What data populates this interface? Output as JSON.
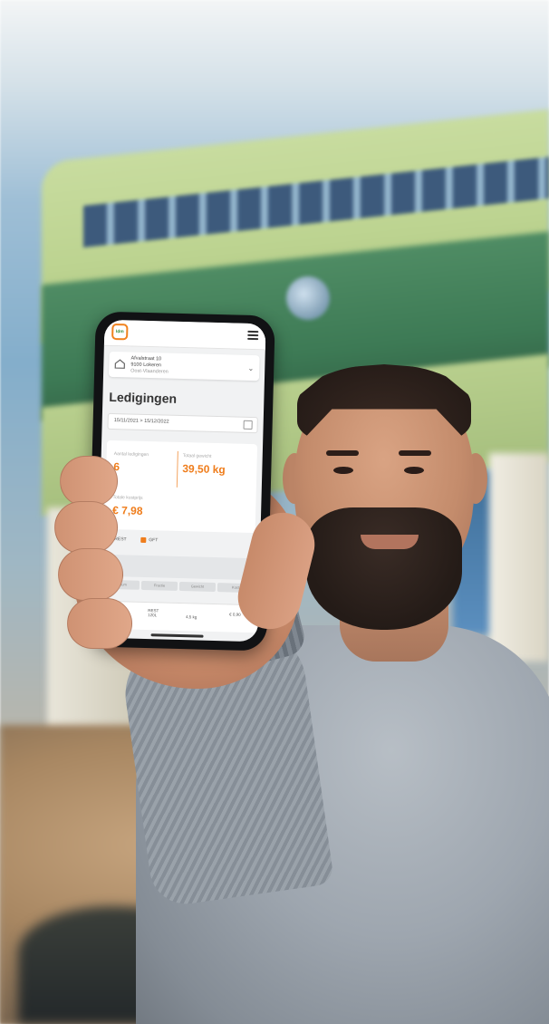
{
  "app": {
    "title": "Ledigingen",
    "logo_text": "Idm",
    "accent_color": "#ef7d1c",
    "icons": [
      "home-icon",
      "menu-icon",
      "chevron-down-icon",
      "calendar-icon"
    ]
  },
  "address": {
    "line1": "Afvalstraat 10",
    "line2": "9100 Lokeren",
    "line3": "Oost-Vlaanderen"
  },
  "filter": {
    "date_range": "15/11/2021 > 15/12/2022"
  },
  "stats": {
    "count_label": "Aantal ledigingen",
    "count_value": "6",
    "weight_label": "Totaal gewicht",
    "weight_value": "39,50 kg",
    "cost_label": "Totale kostprijs",
    "cost_value": "€ 7,98"
  },
  "legend": {
    "item1": "REST",
    "item2": "GFT"
  },
  "tabs": [
    "Datum",
    "Fractie",
    "Gewicht",
    "Kost"
  ],
  "table": {
    "col1": "12/11/2022",
    "col2_line1": "REST",
    "col2_line2": "120L",
    "col3": "4,5 kg",
    "col4": "€ 0,90"
  }
}
